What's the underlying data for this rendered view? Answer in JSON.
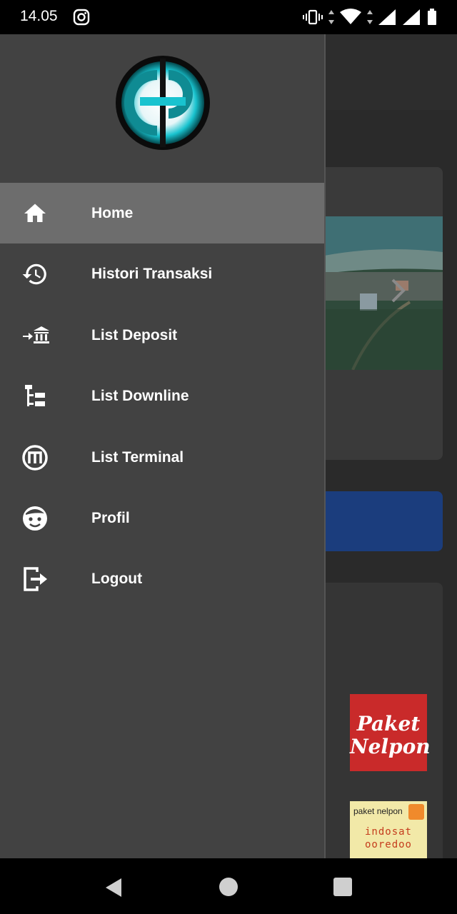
{
  "status_bar": {
    "time": "14.05",
    "icons": [
      "instagram-icon",
      "vibrate-icon",
      "wifi-icon",
      "signal-icon",
      "signal-icon",
      "battery-icon"
    ]
  },
  "drawer": {
    "logo_icon": "gp-logo",
    "items": [
      {
        "label": "Home",
        "icon": "home-icon",
        "active": true
      },
      {
        "label": "Histori Transaksi",
        "icon": "history-icon",
        "active": false
      },
      {
        "label": "List Deposit",
        "icon": "bank-deposit-icon",
        "active": false
      },
      {
        "label": "List Downline",
        "icon": "tree-icon",
        "active": false
      },
      {
        "label": "List Terminal",
        "icon": "terminal-m-icon",
        "active": false
      },
      {
        "label": "Profil",
        "icon": "face-icon",
        "active": false
      },
      {
        "label": "Logout",
        "icon": "logout-icon",
        "active": false
      }
    ]
  },
  "background": {
    "promo_paket_nelpon": "Paket Nelpon",
    "promo_header": "paket nelpon",
    "promo_brand": "indosat ooredoo"
  },
  "nav_bar": {
    "icons": [
      "back-icon",
      "home-circle-icon",
      "recents-icon"
    ]
  },
  "colors": {
    "drawer_bg": "#424242",
    "active_item_bg": "#6d6d6d",
    "accent_cyan": "#19c3cf",
    "banner_blue": "#1b3d7d"
  }
}
